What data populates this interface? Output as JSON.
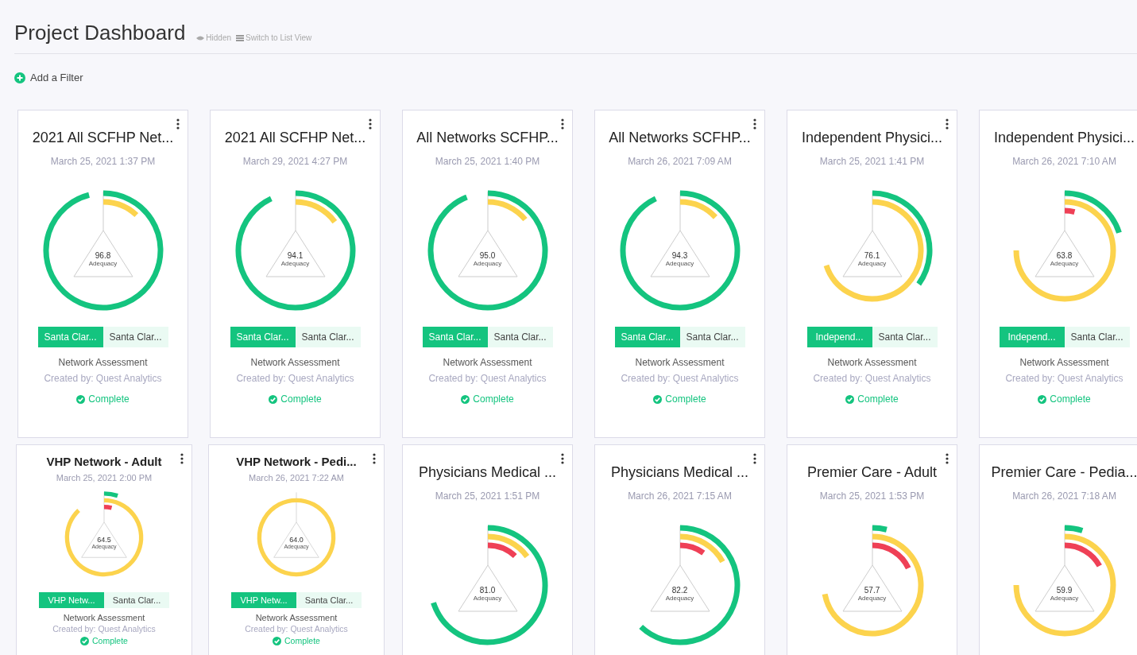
{
  "header": {
    "title": "Project Dashboard",
    "hidden_link": "Hidden",
    "list_view_link": "Switch to List View"
  },
  "filter": {
    "label": "Add a Filter"
  },
  "cards": [
    {
      "title": "2021 All SCFHP Net...",
      "date": "March 25, 2021 1:37 PM",
      "score": "96.8",
      "score_label": "Adequacy",
      "compact": false,
      "tags": [
        {
          "label": "Santa Clar...",
          "selected": true
        },
        {
          "label": "Santa Clar...",
          "selected": false
        }
      ],
      "type": "Network Assessment",
      "creator": "Created by: Quest Analytics",
      "status": "Complete"
    },
    {
      "title": "2021 All SCFHP Net...",
      "date": "March 29, 2021 4:27 PM",
      "score": "94.1",
      "score_label": "Adequacy",
      "compact": false,
      "tags": [
        {
          "label": "Santa Clar...",
          "selected": true
        },
        {
          "label": "Santa Clar...",
          "selected": false
        }
      ],
      "type": "Network Assessment",
      "creator": "Created by: Quest Analytics",
      "status": "Complete"
    },
    {
      "title": "All Networks SCFHP...",
      "date": "March 25, 2021 1:40 PM",
      "score": "95.0",
      "score_label": "Adequacy",
      "compact": false,
      "tags": [
        {
          "label": "Santa Clar...",
          "selected": true
        },
        {
          "label": "Santa Clar...",
          "selected": false
        }
      ],
      "type": "Network Assessment",
      "creator": "Created by: Quest Analytics",
      "status": "Complete"
    },
    {
      "title": "All Networks SCFHP...",
      "date": "March 26, 2021 7:09 AM",
      "score": "94.3",
      "score_label": "Adequacy",
      "compact": false,
      "tags": [
        {
          "label": "Santa Clar...",
          "selected": true
        },
        {
          "label": "Santa Clar...",
          "selected": false
        }
      ],
      "type": "Network Assessment",
      "creator": "Created by: Quest Analytics",
      "status": "Complete"
    },
    {
      "title": "Independent Physici...",
      "date": "March 25, 2021 1:41 PM",
      "score": "76.1",
      "score_label": "Adequacy",
      "compact": false,
      "tags": [
        {
          "label": "Independ...",
          "selected": true
        },
        {
          "label": "Santa Clar...",
          "selected": false
        }
      ],
      "type": "Network Assessment",
      "creator": "Created by: Quest Analytics",
      "status": "Complete"
    },
    {
      "title": "Independent Physici...",
      "date": "March 26, 2021 7:10 AM",
      "score": "63.8",
      "score_label": "Adequacy",
      "compact": false,
      "tags": [
        {
          "label": "Independ...",
          "selected": true
        },
        {
          "label": "Santa Clar...",
          "selected": false
        }
      ],
      "type": "Network Assessment",
      "creator": "Created by: Quest Analytics",
      "status": "Complete"
    },
    {
      "title": "VHP Network - Adult",
      "date": "March 25, 2021 2:00 PM",
      "score": "64.5",
      "score_label": "Adequacy",
      "compact": true,
      "tags": [
        {
          "label": "VHP Netw...",
          "selected": true
        },
        {
          "label": "Santa Clar...",
          "selected": false
        }
      ],
      "type": "Network Assessment",
      "creator": "Created by: Quest Analytics",
      "status": "Complete"
    },
    {
      "title": "VHP Network - Pedi...",
      "date": "March 26, 2021 7:22 AM",
      "score": "64.0",
      "score_label": "Adequacy",
      "compact": true,
      "tags": [
        {
          "label": "VHP Netw...",
          "selected": true
        },
        {
          "label": "Santa Clar...",
          "selected": false
        }
      ],
      "type": "Network Assessment",
      "creator": "Created by: Quest Analytics",
      "status": "Complete"
    },
    {
      "title": "Physicians Medical ...",
      "date": "March 25, 2021 1:51 PM",
      "score": "81.0",
      "score_label": "Adequacy",
      "compact": false
    },
    {
      "title": "Physicians Medical ...",
      "date": "March 26, 2021 7:15 AM",
      "score": "82.2",
      "score_label": "Adequacy",
      "compact": false
    },
    {
      "title": "Premier Care - Adult",
      "date": "March 25, 2021 1:53 PM",
      "score": "57.7",
      "score_label": "Adequacy",
      "compact": false
    },
    {
      "title": "Premier Care - Pedia...",
      "date": "March 26, 2021 7:18 AM",
      "score": "59.9",
      "score_label": "Adequacy",
      "compact": false
    }
  ]
}
